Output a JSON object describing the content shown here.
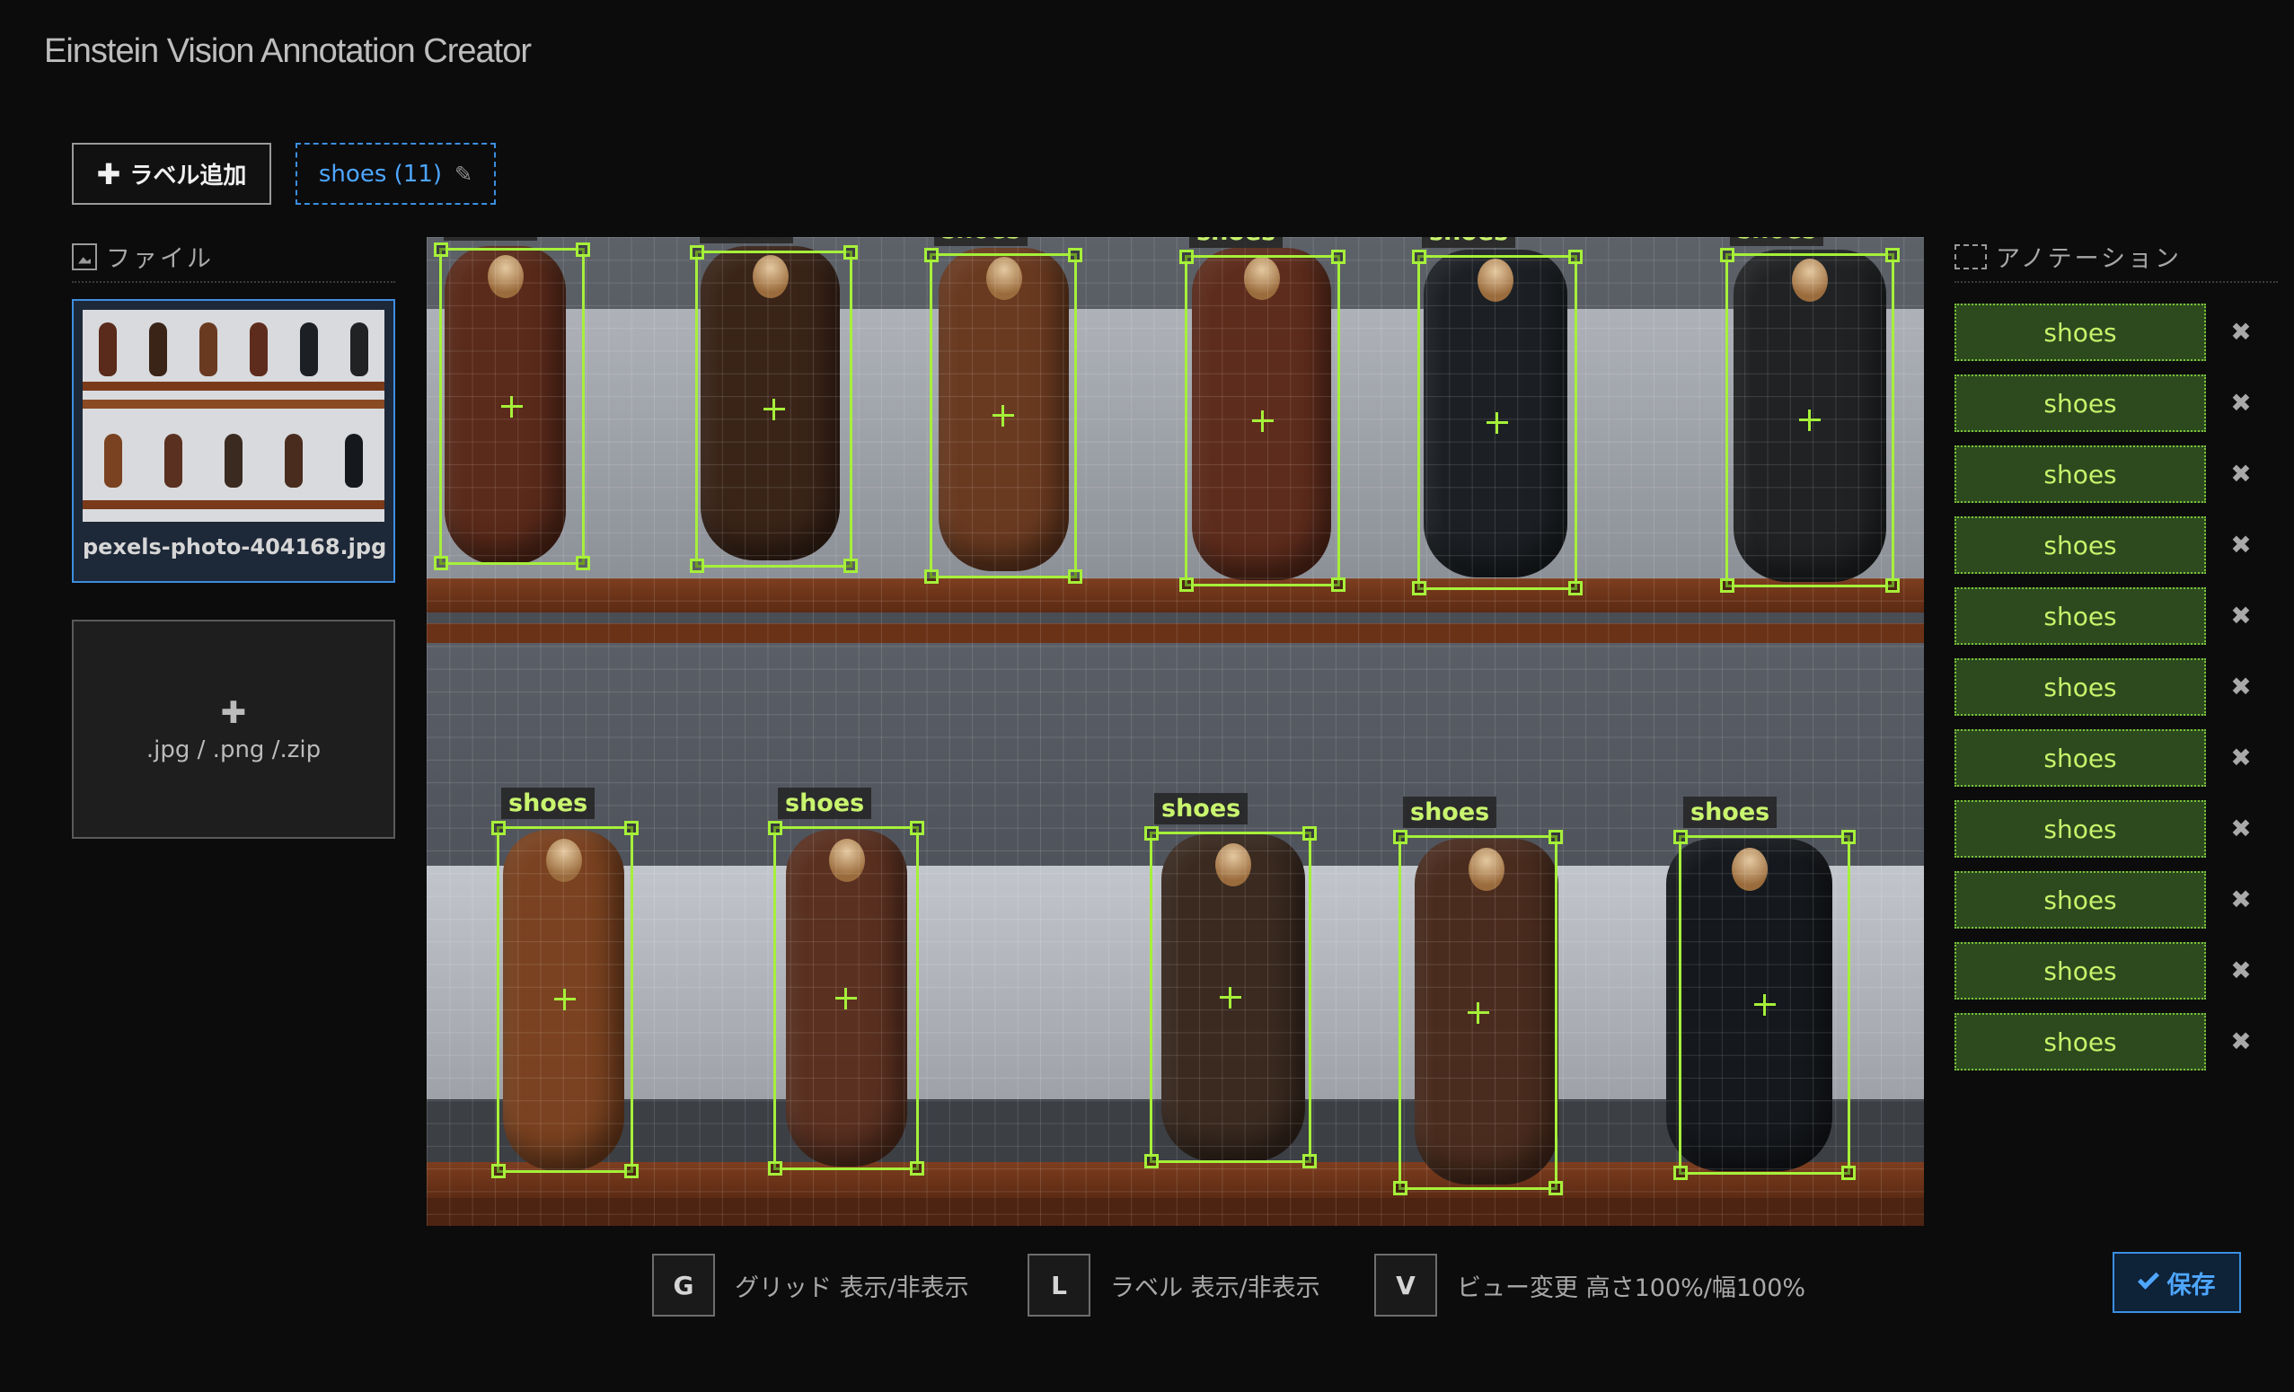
{
  "app": {
    "title": "Einstein Vision Annotation Creator"
  },
  "toolbar": {
    "add_label": "ラベル追加",
    "label_chip": "shoes (11)"
  },
  "files": {
    "header": "ファイル",
    "items": [
      {
        "name": "pexels-photo-404168.jpg"
      }
    ],
    "upload_hint": ".jpg / .png /.zip"
  },
  "annotations": {
    "header": "アノテーション",
    "items": [
      {
        "label": "shoes"
      },
      {
        "label": "shoes"
      },
      {
        "label": "shoes"
      },
      {
        "label": "shoes"
      },
      {
        "label": "shoes"
      },
      {
        "label": "shoes"
      },
      {
        "label": "shoes"
      },
      {
        "label": "shoes"
      },
      {
        "label": "shoes"
      },
      {
        "label": "shoes"
      },
      {
        "label": "shoes"
      }
    ]
  },
  "boxes": [
    {
      "label": "shoes",
      "color": "#5a2a1a"
    },
    {
      "label": "shoes",
      "color": "#3a2418"
    },
    {
      "label": "shoes",
      "color": "#6a3a20"
    },
    {
      "label": "shoes",
      "color": "#5e2c1c"
    },
    {
      "label": "shoes",
      "color": "#1c2024"
    },
    {
      "label": "shoes",
      "color": "#202224"
    },
    {
      "label": "shoes",
      "color": "#7a4220"
    },
    {
      "label": "shoes",
      "color": "#5a3020"
    },
    {
      "label": "shoes",
      "color": "#3a2a20"
    },
    {
      "label": "shoes",
      "color": "#4a2c1e"
    },
    {
      "label": "shoes",
      "color": "#15181c"
    }
  ],
  "shortcuts": [
    {
      "key": "G",
      "desc": "グリッド 表示/非表示"
    },
    {
      "key": "L",
      "desc": "ラベル 表示/非表示"
    },
    {
      "key": "V",
      "desc": "ビュー変更 高さ100%/幅100%"
    }
  ],
  "save": {
    "label": "保存"
  },
  "colors": {
    "accent": "#3b8fe2",
    "box": "#a6f03a",
    "tag_bg": "#2c4a1e"
  }
}
